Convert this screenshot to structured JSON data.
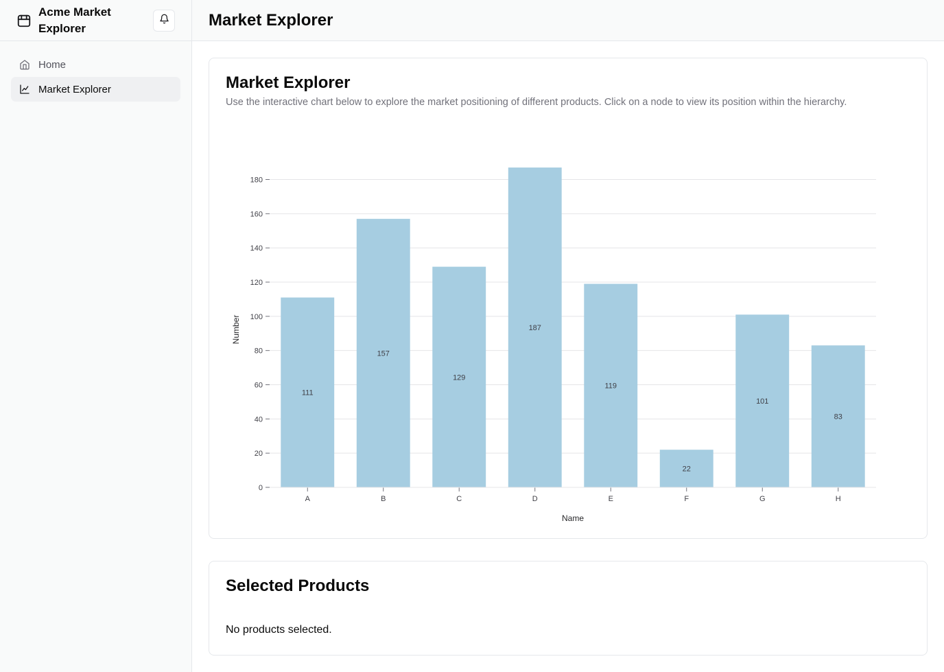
{
  "sidebar": {
    "brand": "Acme Market Explorer",
    "items": [
      {
        "label": "Home",
        "icon": "home-icon",
        "active": false
      },
      {
        "label": "Market Explorer",
        "icon": "line-chart-icon",
        "active": true
      }
    ]
  },
  "header": {
    "title": "Market Explorer"
  },
  "chart_card": {
    "title": "Market Explorer",
    "description": "Use the interactive chart below to explore the market positioning of different products. Click on a node to view its position within the hierarchy."
  },
  "products_card": {
    "title": "Selected Products",
    "empty_text": "No products selected."
  },
  "colors": {
    "bar": "#a6cde1",
    "grid": "#e4e4e7"
  },
  "chart_data": {
    "type": "bar",
    "categories": [
      "A",
      "B",
      "C",
      "D",
      "E",
      "F",
      "G",
      "H"
    ],
    "values": [
      111,
      157,
      129,
      187,
      119,
      22,
      101,
      83
    ],
    "title": "",
    "xlabel": "Name",
    "ylabel": "Number",
    "ylim": [
      0,
      180
    ],
    "yticks": [
      0,
      20,
      40,
      60,
      80,
      100,
      120,
      140,
      160,
      180
    ],
    "grid": true,
    "legend": false,
    "data_labels": true
  }
}
